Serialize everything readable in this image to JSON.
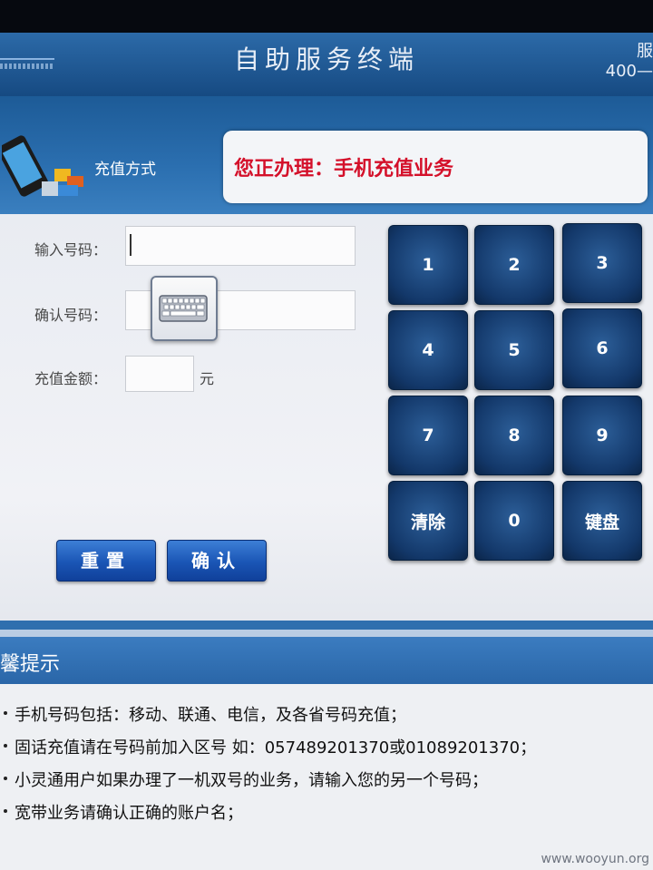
{
  "header": {
    "title": "自助服务终端",
    "right_top": "服",
    "right_bottom": "400—"
  },
  "band": {
    "method_label": "充值方式",
    "notice": "您正办理：手机充值业务"
  },
  "form": {
    "phone_label": "输入号码：",
    "confirm_label": "确认号码：",
    "amount_label": "充值金额：",
    "amount_unit": "元",
    "phone_value": "",
    "confirm_value": "",
    "amount_value": ""
  },
  "buttons": {
    "reset": "重置",
    "confirm": "确认"
  },
  "keypad": {
    "keys": [
      "1",
      "2",
      "3",
      "4",
      "5",
      "6",
      "7",
      "8",
      "9",
      "清除",
      "0",
      "键盘"
    ]
  },
  "tips": {
    "title": "馨提示",
    "items": [
      "手机号码包括：移动、联通、电信，及各省号码充值；",
      "固话充值请在号码前加入区号 如：057489201370或01089201370；",
      "小灵通用户如果办理了一机双号的业务，请输入您的另一个号码；",
      "宽带业务请确认正确的账户名；"
    ]
  },
  "watermark": "www.wooyun.org",
  "colors": {
    "header_blue": "#1d5b97",
    "notice_red": "#d4102a",
    "key_navy": "#13386a",
    "button_blue": "#1a55b5"
  },
  "icons": {
    "keyboard_popup": "keyboard-icon",
    "phone": "phone-icon"
  }
}
